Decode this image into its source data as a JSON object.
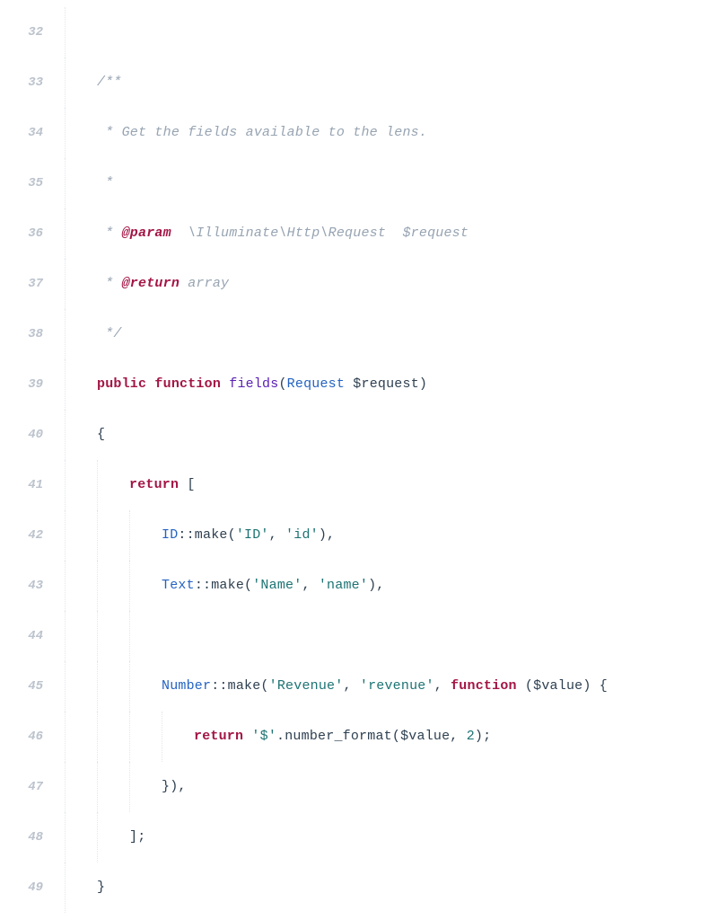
{
  "lines": [
    {
      "num": "32",
      "indent": 1,
      "tokens": []
    },
    {
      "num": "33",
      "indent": 1,
      "tokens": [
        {
          "cls": "comment",
          "text": "/**"
        }
      ]
    },
    {
      "num": "34",
      "indent": 1,
      "tokens": [
        {
          "cls": "comment",
          "text": " * Get the fields available to the lens."
        }
      ]
    },
    {
      "num": "35",
      "indent": 1,
      "tokens": [
        {
          "cls": "comment",
          "text": " *"
        }
      ]
    },
    {
      "num": "36",
      "indent": 1,
      "tokens": [
        {
          "cls": "comment",
          "text": " * "
        },
        {
          "cls": "doctag",
          "text": "@param"
        },
        {
          "cls": "comment",
          "text": "  \\Illuminate\\Http\\Request  $request"
        }
      ]
    },
    {
      "num": "37",
      "indent": 1,
      "tokens": [
        {
          "cls": "comment",
          "text": " * "
        },
        {
          "cls": "doctag",
          "text": "@return"
        },
        {
          "cls": "comment",
          "text": " array"
        }
      ]
    },
    {
      "num": "38",
      "indent": 1,
      "tokens": [
        {
          "cls": "comment",
          "text": " */"
        }
      ]
    },
    {
      "num": "39",
      "indent": 1,
      "tokens": [
        {
          "cls": "keyword",
          "text": "public"
        },
        {
          "cls": "punct",
          "text": " "
        },
        {
          "cls": "keyword",
          "text": "function"
        },
        {
          "cls": "punct",
          "text": " "
        },
        {
          "cls": "funcname",
          "text": "fields"
        },
        {
          "cls": "punct",
          "text": "("
        },
        {
          "cls": "type",
          "text": "Request"
        },
        {
          "cls": "punct",
          "text": " "
        },
        {
          "cls": "variable",
          "text": "$request"
        },
        {
          "cls": "punct",
          "text": ")"
        }
      ]
    },
    {
      "num": "40",
      "indent": 1,
      "tokens": [
        {
          "cls": "punct",
          "text": "{"
        }
      ]
    },
    {
      "num": "41",
      "indent": 2,
      "tokens": [
        {
          "cls": "keyword",
          "text": "return"
        },
        {
          "cls": "punct",
          "text": " ["
        }
      ]
    },
    {
      "num": "42",
      "indent": 3,
      "tokens": [
        {
          "cls": "classname",
          "text": "ID"
        },
        {
          "cls": "punct",
          "text": "::make("
        },
        {
          "cls": "string",
          "text": "'ID'"
        },
        {
          "cls": "punct",
          "text": ", "
        },
        {
          "cls": "string",
          "text": "'id'"
        },
        {
          "cls": "punct",
          "text": "),"
        }
      ]
    },
    {
      "num": "43",
      "indent": 3,
      "tokens": [
        {
          "cls": "classname",
          "text": "Text"
        },
        {
          "cls": "punct",
          "text": "::make("
        },
        {
          "cls": "string",
          "text": "'Name'"
        },
        {
          "cls": "punct",
          "text": ", "
        },
        {
          "cls": "string",
          "text": "'name'"
        },
        {
          "cls": "punct",
          "text": "),"
        }
      ]
    },
    {
      "num": "44",
      "indent": 3,
      "tokens": []
    },
    {
      "num": "45",
      "indent": 3,
      "tokens": [
        {
          "cls": "classname",
          "text": "Number"
        },
        {
          "cls": "punct",
          "text": "::make("
        },
        {
          "cls": "string",
          "text": "'Revenue'"
        },
        {
          "cls": "punct",
          "text": ", "
        },
        {
          "cls": "string",
          "text": "'revenue'"
        },
        {
          "cls": "punct",
          "text": ", "
        },
        {
          "cls": "keyword",
          "text": "function"
        },
        {
          "cls": "punct",
          "text": " ("
        },
        {
          "cls": "variable",
          "text": "$value"
        },
        {
          "cls": "punct",
          "text": ") {"
        }
      ]
    },
    {
      "num": "46",
      "indent": 4,
      "tokens": [
        {
          "cls": "keyword",
          "text": "return"
        },
        {
          "cls": "punct",
          "text": " "
        },
        {
          "cls": "string",
          "text": "'$'"
        },
        {
          "cls": "punct",
          "text": ".number_format("
        },
        {
          "cls": "variable",
          "text": "$value"
        },
        {
          "cls": "punct",
          "text": ", "
        },
        {
          "cls": "number",
          "text": "2"
        },
        {
          "cls": "punct",
          "text": ");"
        }
      ]
    },
    {
      "num": "47",
      "indent": 3,
      "tokens": [
        {
          "cls": "punct",
          "text": "}),"
        }
      ]
    },
    {
      "num": "48",
      "indent": 2,
      "tokens": [
        {
          "cls": "punct",
          "text": "];"
        }
      ]
    },
    {
      "num": "49",
      "indent": 1,
      "tokens": [
        {
          "cls": "punct",
          "text": "}"
        }
      ]
    }
  ]
}
